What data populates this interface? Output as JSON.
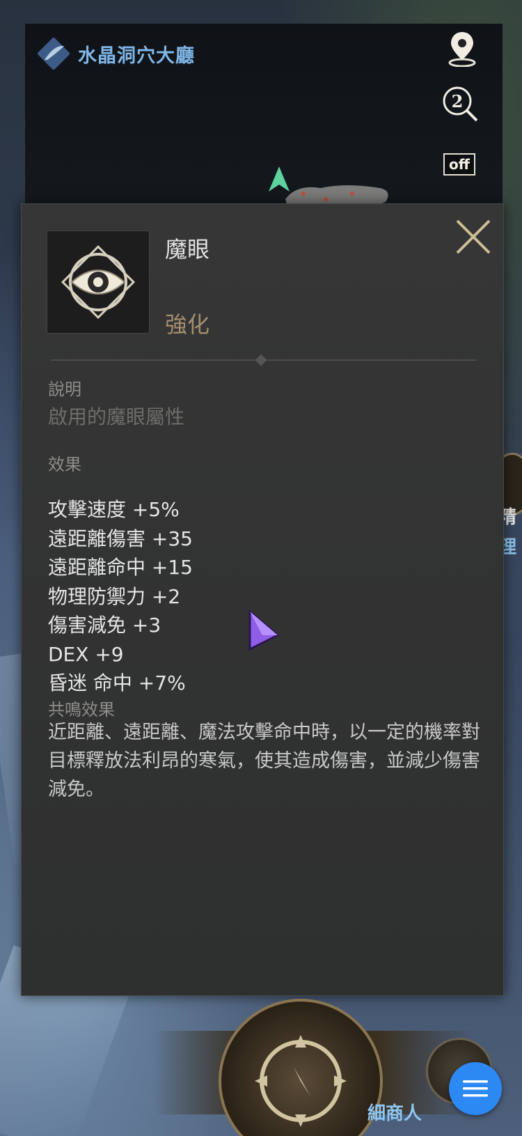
{
  "minimap": {
    "location_name": "水晶洞穴大廳",
    "toggle_label": "off",
    "location_icon": "feather-icon",
    "buttons": [
      "map-pin-icon",
      "zoom-level-icon",
      "auto-toggle-off"
    ]
  },
  "tooltip": {
    "item_name": "魔眼",
    "item_grade": "強化",
    "icon": "magic-eye-icon",
    "description_label": "說明",
    "description_text": "啟用的魔眼屬性",
    "effects_label": "效果",
    "effects": [
      "攻擊速度 +5%",
      "遠距離傷害 +35",
      "遠距離命中 +15",
      "物理防禦力 +2",
      "傷害減免 +3",
      "DEX +9",
      "昏迷 命中 +7%"
    ],
    "resonance_label": "共鳴效果",
    "resonance_text": "近距離、遠距離、魔法攻擊命中時，以一定的機率對目標釋放法利昂的寒氣，使其造成傷害，並減少傷害減免。"
  },
  "hud": {
    "merchant_label": "細商人",
    "edge_label_1": "精",
    "edge_label_2": "理"
  },
  "colors": {
    "location_text": "#7fb7e9",
    "grade_text": "#a58e6f",
    "menu_button": "#2c88f3"
  }
}
